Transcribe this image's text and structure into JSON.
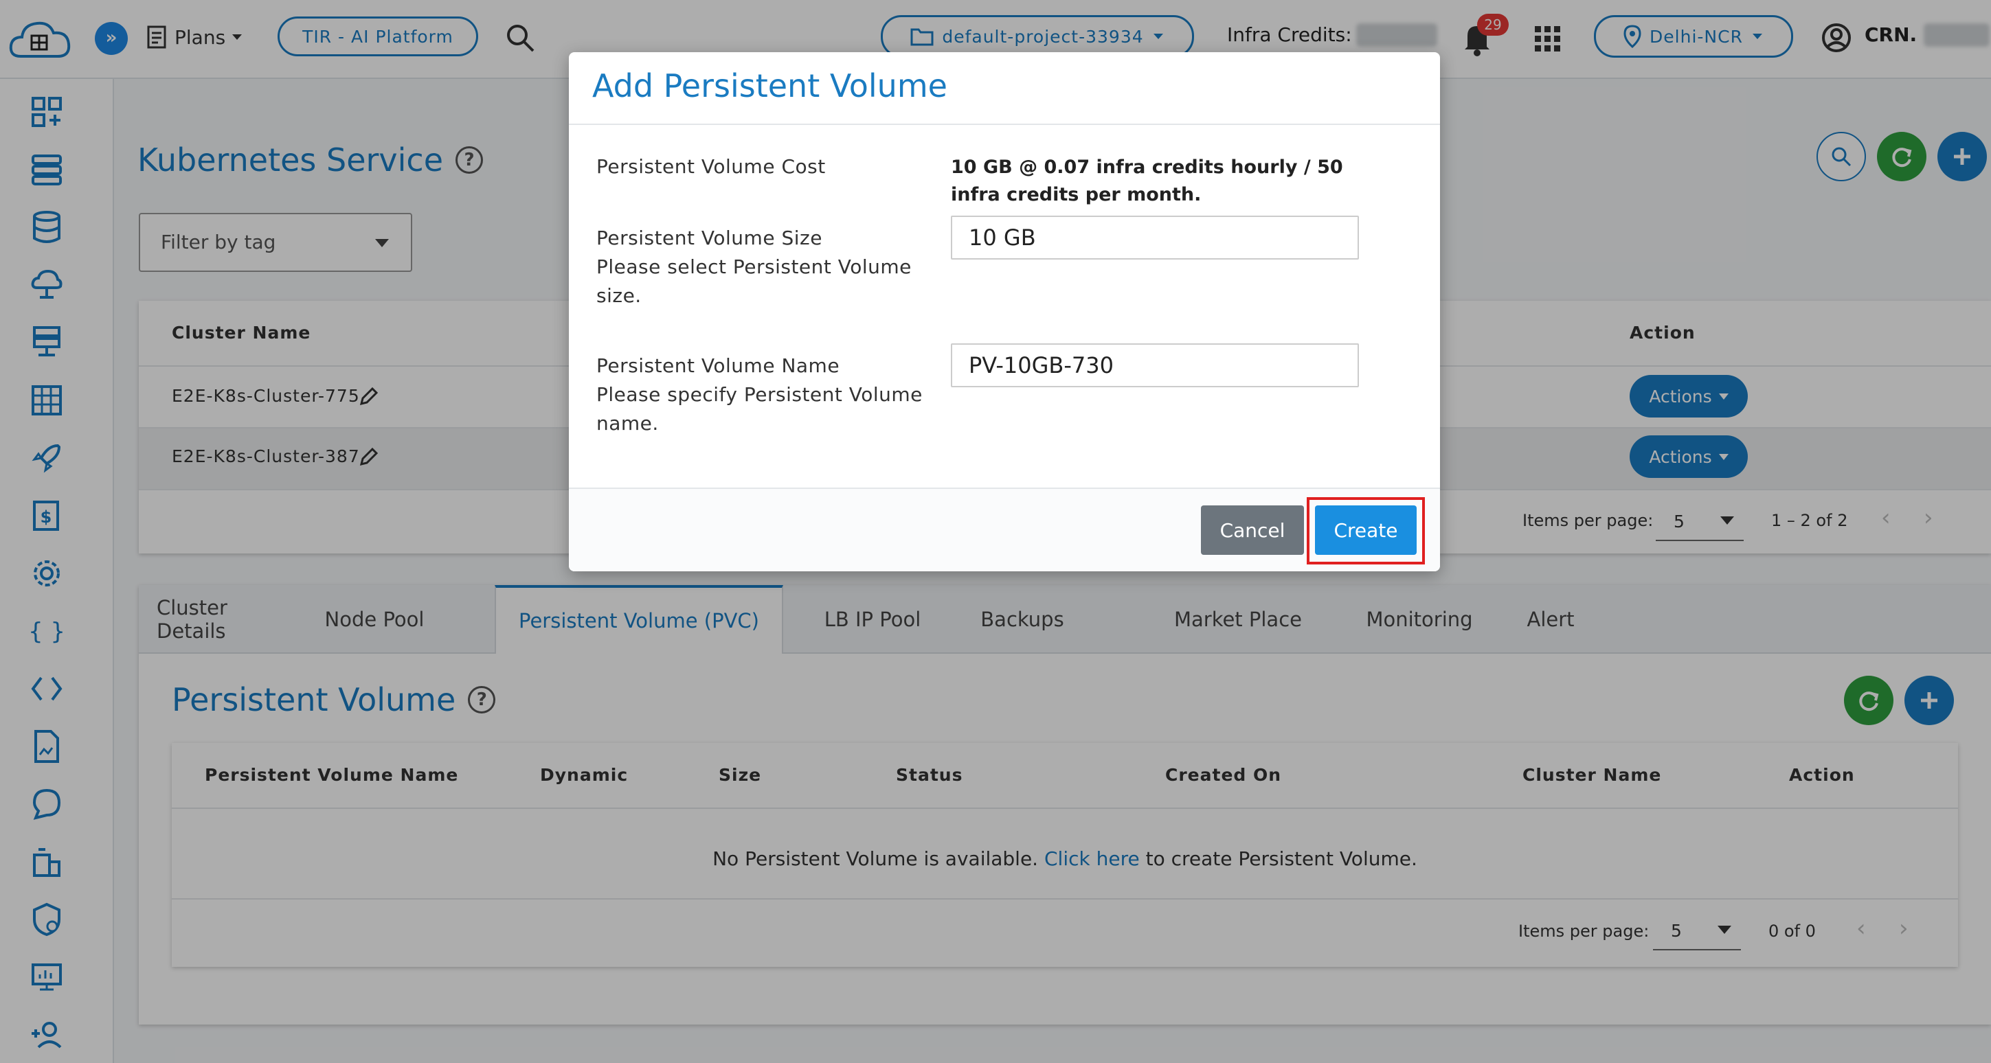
{
  "topbar": {
    "plans_label": "Plans",
    "tir_label": "TIR - AI Platform",
    "project_label": "default-project-33934",
    "credits_label": "Infra Credits:",
    "notification_count": "29",
    "region_label": "Delhi-NCR",
    "user_label": "CRN.",
    "accent_color": "#1a7bc1"
  },
  "sidebar": {
    "items": [
      "dashboard-icon",
      "nodes-icon",
      "database-icon",
      "cloud-icon",
      "network-icon",
      "table-icon",
      "rocket-icon",
      "billing-icon",
      "settings-icon",
      "braces-icon",
      "code-icon",
      "document-icon",
      "chat-icon",
      "building-icon",
      "security-icon",
      "monitor-icon",
      "add-user-icon"
    ]
  },
  "main": {
    "title": "Kubernetes Service",
    "help": "?",
    "filter_placeholder": "Filter by tag",
    "cluster_table": {
      "headers": [
        "Cluster Name",
        "Action"
      ],
      "rows": [
        {
          "name": "E2E-K8s-Cluster-775",
          "action": "Actions"
        },
        {
          "name": "E2E-K8s-Cluster-387",
          "action": "Actions"
        }
      ],
      "items_per_page_label": "Items per page:",
      "items_per_page": "5",
      "range": "1 – 2 of 2"
    },
    "tabs": [
      {
        "label": "Cluster Details"
      },
      {
        "label": "Node Pool"
      },
      {
        "label": "Persistent Volume (PVC)"
      },
      {
        "label": "LB IP Pool"
      },
      {
        "label": "Backups"
      },
      {
        "label": "Market Place"
      },
      {
        "label": "Monitoring"
      },
      {
        "label": "Alert"
      }
    ],
    "pv_section": {
      "title": "Persistent Volume",
      "help": "?",
      "headers": [
        "Persistent Volume Name",
        "Dynamic",
        "Size",
        "Status",
        "Created On",
        "Cluster Name",
        "Action"
      ],
      "empty_prefix": "No Persistent Volume is available.",
      "empty_link": "Click here",
      "empty_suffix": "to create Persistent Volume.",
      "items_per_page_label": "Items per page:",
      "items_per_page": "5",
      "range": "0 of 0"
    }
  },
  "modal": {
    "title": "Add Persistent Volume",
    "cost_label": "Persistent Volume Cost",
    "cost_value": "10 GB @ 0.07 infra credits hourly / 50 infra credits per month.",
    "size_label": "Persistent Volume Size",
    "size_hint": "Please select Persistent Volume size.",
    "size_value": "10 GB",
    "name_label": "Persistent Volume Name",
    "name_hint": "Please specify Persistent Volume name.",
    "name_value": "PV-10GB-730",
    "cancel_label": "Cancel",
    "create_label": "Create"
  }
}
